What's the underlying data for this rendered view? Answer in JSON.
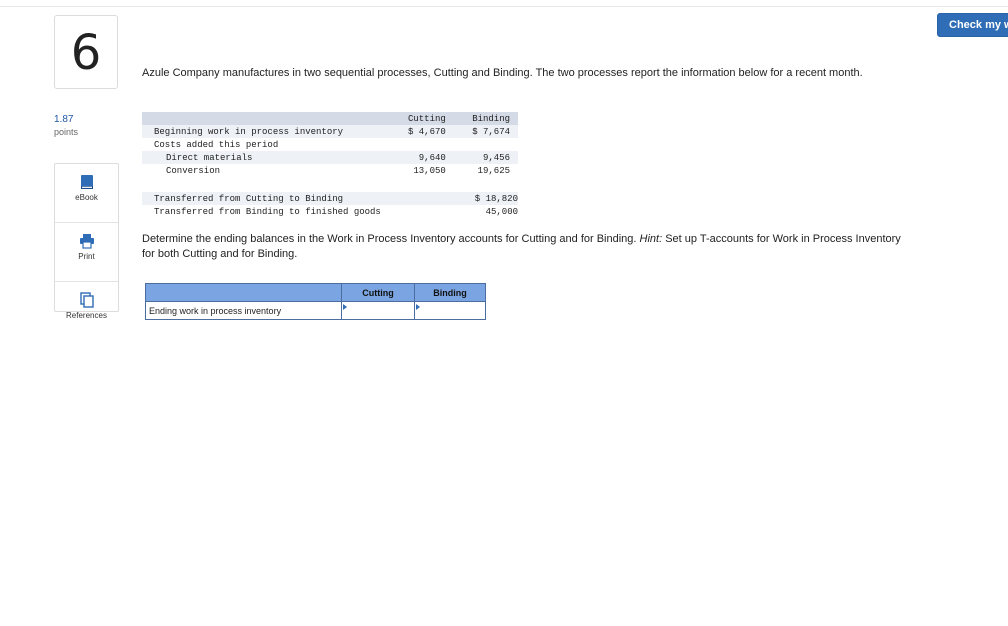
{
  "header": {
    "check_button_label": "Check my w"
  },
  "question": {
    "number": "6",
    "points_value": "1.87",
    "points_label": "points"
  },
  "tools": [
    {
      "label": "eBook",
      "icon": "book-icon"
    },
    {
      "label": "Print",
      "icon": "printer-icon"
    },
    {
      "label": "References",
      "icon": "references-icon"
    }
  ],
  "intro_text": "Azule Company manufactures in two sequential processes, Cutting and Binding. The two processes report the information below for a recent month.",
  "data_table": {
    "col_cutting": "Cutting",
    "col_binding": "Binding",
    "rows": [
      {
        "label": "Beginning work in process inventory",
        "cutting": "$ 4,670",
        "binding": "$ 7,674"
      },
      {
        "label": "Costs added this period",
        "cutting": "",
        "binding": ""
      },
      {
        "label": "Direct materials",
        "cutting": "9,640",
        "binding": "9,456"
      },
      {
        "label": "Conversion",
        "cutting": "13,050",
        "binding": "19,625"
      },
      {
        "label": "Transferred from Cutting to Binding",
        "cutting": "",
        "binding": "$ 18,820"
      },
      {
        "label": "Transferred from Binding to finished goods",
        "cutting": "",
        "binding": "45,000"
      }
    ]
  },
  "prompt": {
    "text_before_hint": "Determine the ending balances in the Work in Process Inventory accounts for Cutting and for Binding. ",
    "hint_label": "Hint:",
    "text_after_hint": " Set up T-accounts for Work in Process Inventory for both Cutting and for Binding."
  },
  "answer_table": {
    "col_cutting": "Cutting",
    "col_binding": "Binding",
    "row_label": "Ending work in process inventory",
    "cutting_value": "",
    "binding_value": ""
  },
  "colors": {
    "accent": "#2f6db6",
    "table_header": "#7aa5e2",
    "data_header": "#d5dbe6",
    "points": "#1f57a4"
  }
}
